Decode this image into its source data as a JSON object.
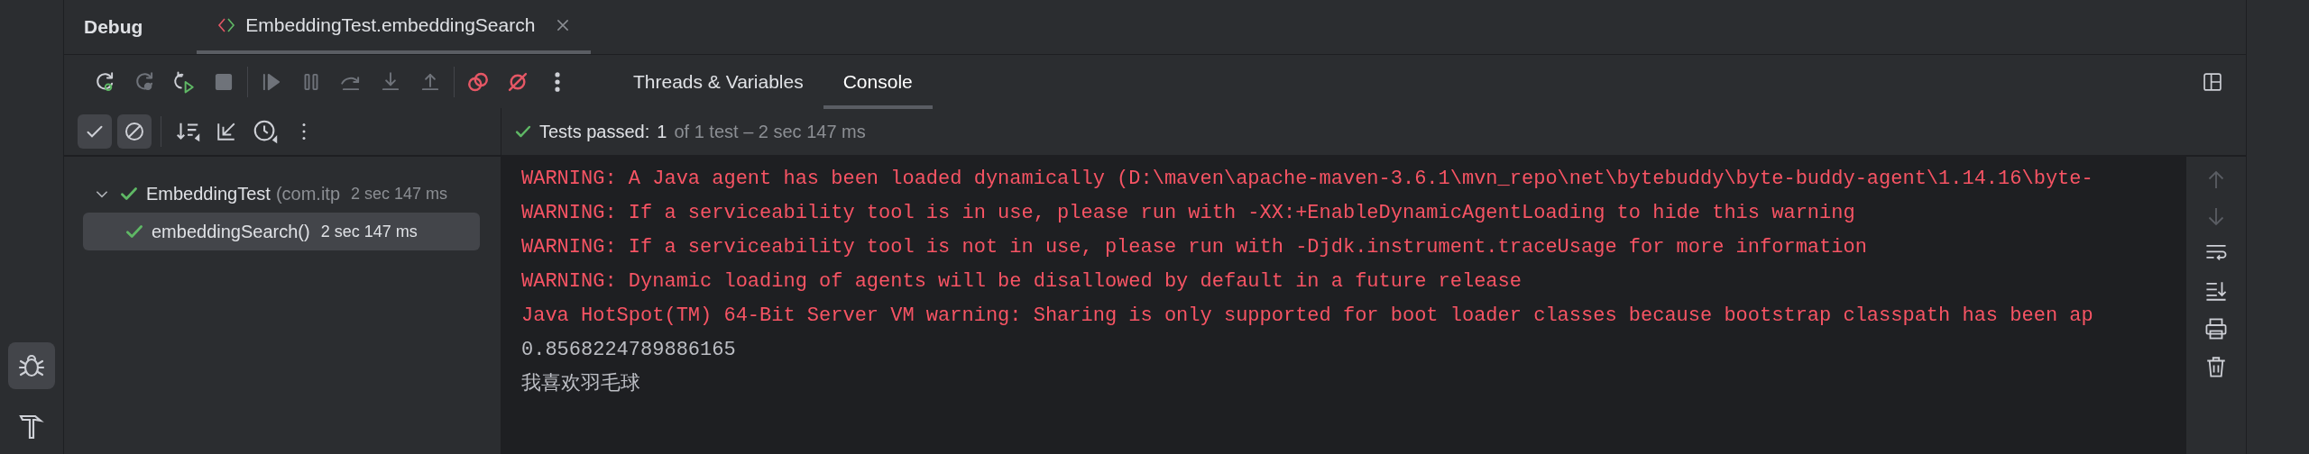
{
  "tool_windows": [
    {
      "kind": "debug",
      "selected": true
    },
    {
      "kind": "build",
      "selected": false
    }
  ],
  "header": {
    "title": "Debug",
    "tabs": [
      {
        "label": "EmbeddingTest.embeddingSearch",
        "selected": true
      }
    ]
  },
  "toolbar": [
    {
      "kind": "rerun",
      "disabled": false
    },
    {
      "kind": "rerun-failed",
      "disabled": true
    },
    {
      "kind": "restart",
      "disabled": false
    },
    {
      "kind": "stop",
      "disabled": true
    },
    {
      "kind": "resume",
      "disabled": true
    },
    {
      "kind": "pause",
      "disabled": true
    },
    {
      "kind": "step-over",
      "disabled": true
    },
    {
      "kind": "step-into",
      "disabled": true
    },
    {
      "kind": "step-out",
      "disabled": true
    },
    {
      "kind": "breakpoints",
      "disabled": false
    },
    {
      "kind": "mute",
      "disabled": false
    },
    {
      "kind": "more",
      "disabled": false
    }
  ],
  "view_tabs": [
    {
      "label": "Threads & Variables",
      "selected": false
    },
    {
      "label": "Console",
      "selected": true
    }
  ],
  "test_toggles": [
    {
      "kind": "passed",
      "selected": true
    },
    {
      "kind": "ignored",
      "selected": true
    }
  ],
  "test_status": {
    "label": "Tests passed:",
    "count": "1",
    "detail": "of 1 test – 2 sec 147 ms"
  },
  "tree": [
    {
      "name": "EmbeddingTest",
      "package": "(com.itp",
      "duration": "2 sec 147 ms",
      "selected": false,
      "expanded": true,
      "children": [
        {
          "name": "embeddingSearch()",
          "duration": "2 sec 147 ms",
          "selected": true
        }
      ]
    }
  ],
  "console": [
    {
      "kind": "stderr",
      "text": "WARNING: A Java agent has been loaded dynamically (D:\\maven\\apache-maven-3.6.1\\mvn_repo\\net\\bytebuddy\\byte-buddy-agent\\1.14.16\\byte-"
    },
    {
      "kind": "stderr",
      "text": "WARNING: If a serviceability tool is in use, please run with -XX:+EnableDynamicAgentLoading to hide this warning"
    },
    {
      "kind": "stderr",
      "text": "WARNING: If a serviceability tool is not in use, please run with -Djdk.instrument.traceUsage for more information"
    },
    {
      "kind": "stderr",
      "text": "WARNING: Dynamic loading of agents will be disallowed by default in a future release"
    },
    {
      "kind": "stderr",
      "text": "Java HotSpot(TM) 64-Bit Server VM warning: Sharing is only supported for boot loader classes because bootstrap classpath has been ap"
    },
    {
      "kind": "stdout",
      "text": "0.8568224789886165"
    },
    {
      "kind": "stdout",
      "text": "我喜欢羽毛球"
    }
  ]
}
